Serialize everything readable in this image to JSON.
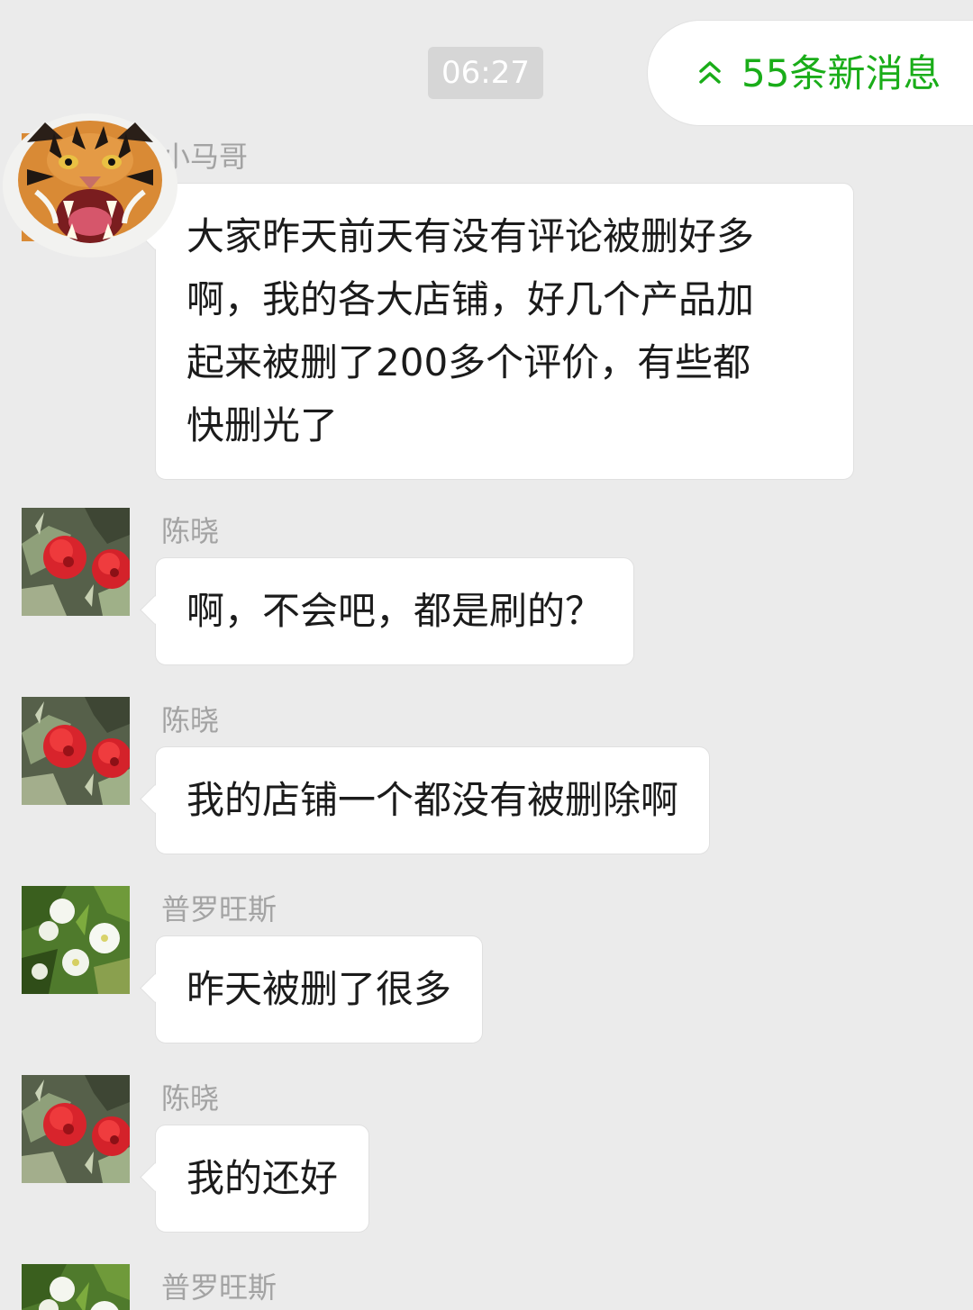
{
  "timestamp": "06:27",
  "new_messages": {
    "label": "55条新消息",
    "color": "#1aad19",
    "icon": "double-chevron-up-icon"
  },
  "messages": [
    {
      "sender": "小马哥",
      "avatar": "tiger-avatar",
      "text": "大家昨天前天有没有评论被删好多\n啊，我的各大店铺，好几个产品加\n起来被删了200多个评价，有些都\n快删光了"
    },
    {
      "sender": "陈晓",
      "avatar": "red-flower-avatar",
      "text": "啊，不会吧，都是刷的？"
    },
    {
      "sender": "陈晓",
      "avatar": "red-flower-avatar",
      "text": "我的店铺一个都没有被删除啊"
    },
    {
      "sender": "普罗旺斯",
      "avatar": "white-flower-avatar",
      "text": "昨天被删了很多"
    },
    {
      "sender": "陈晓",
      "avatar": "red-flower-avatar",
      "text": "我的还好"
    },
    {
      "sender": "普罗旺斯",
      "avatar": "white-flower-avatar",
      "text": ""
    }
  ]
}
